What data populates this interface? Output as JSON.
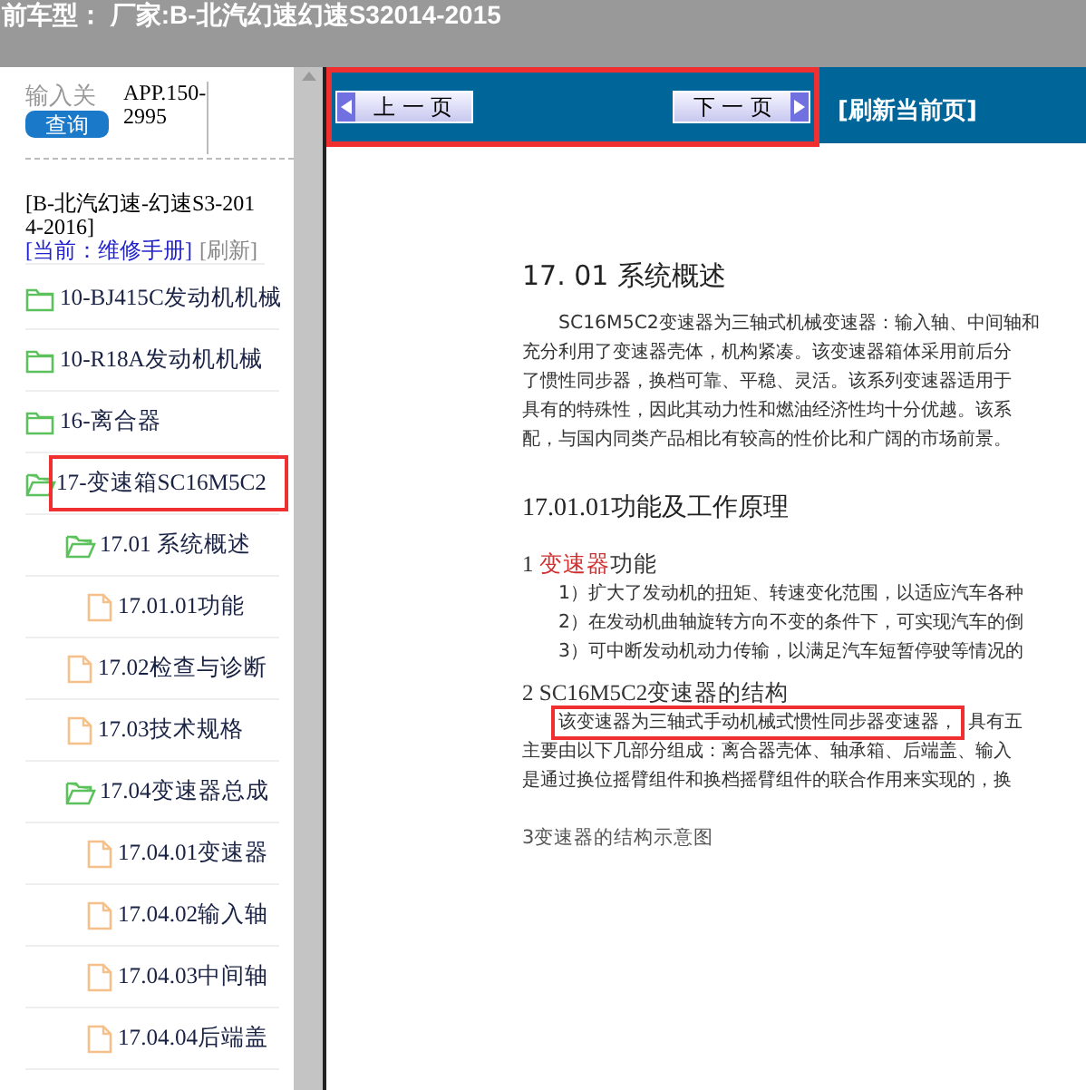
{
  "header": {
    "title": "前车型：  厂家:B-北汽幻速幻速S32014-2015"
  },
  "search": {
    "placeholder": "输入关",
    "code": "APP.150-2995",
    "button": "查询"
  },
  "vehicle": {
    "name": "[B-北汽幻速-幻速S3-2014-2016]",
    "current": "[当前：维修手册]",
    "refresh": "[刷新]"
  },
  "tree": [
    {
      "label": "10-BJ415C发动机机械",
      "kind": "folder",
      "expanded": false,
      "annotated": false
    },
    {
      "label": "10-R18A发动机机械",
      "kind": "folder",
      "expanded": false,
      "annotated": false
    },
    {
      "label": "16-离合器",
      "kind": "folder",
      "expanded": false,
      "annotated": false
    },
    {
      "label": "17-变速箱SC16M5C2",
      "kind": "folder",
      "expanded": true,
      "annotated": true,
      "children": [
        {
          "label": "17.01 系统概述",
          "kind": "folder",
          "expanded": true,
          "annotated": false,
          "children": [
            {
              "label": "17.01.01功能",
              "kind": "file",
              "annotated": false
            }
          ]
        },
        {
          "label": "17.02检查与诊断",
          "kind": "file",
          "annotated": false
        },
        {
          "label": "17.03技术规格",
          "kind": "file",
          "annotated": false
        },
        {
          "label": "17.04变速器总成",
          "kind": "folder",
          "expanded": true,
          "annotated": false,
          "children": [
            {
              "label": "17.04.01变速器",
              "kind": "file",
              "annotated": false
            },
            {
              "label": "17.04.02输入轴",
              "kind": "file",
              "annotated": false
            },
            {
              "label": "17.04.03中间轴",
              "kind": "file",
              "annotated": false
            },
            {
              "label": "17.04.04后端盖",
              "kind": "file",
              "annotated": false
            }
          ]
        }
      ]
    }
  ],
  "pager": {
    "annotated": true,
    "prev": "上 一 页",
    "next": "下 一 页",
    "refresh": "[刷新当前页]"
  },
  "document": [
    {
      "kind": "h1",
      "text": "17. 01 系统概述"
    },
    {
      "kind": "para",
      "lines": [
        {
          "text": "SC16M5C2变速器为三轴式机械变速器：输入轴、中间轴和",
          "indent": true
        },
        {
          "text": "充分利用了变速器壳体，机构紧凑。该变速器箱体采用前后分"
        },
        {
          "text": "了惯性同步器，换档可靠、平稳、灵活。该系列变速器适用于"
        },
        {
          "text": "具有的特殊性，因此其动力性和燃油经济性均十分优越。该系"
        },
        {
          "text": "配，与国内同类产品相比有较高的性价比和广阔的市场前景。"
        }
      ]
    },
    {
      "kind": "h2",
      "text": "17.01.01功能及工作原理"
    },
    {
      "kind": "h3",
      "text": "1 ",
      "highlight": "变速器",
      "after": "功能"
    },
    {
      "kind": "para",
      "lines": [
        {
          "text": "1）扩大了发动机的扭矩、转速变化范围，以适应汽车各种",
          "indent": true
        },
        {
          "text": "2）在发动机曲轴旋转方向不变的条件下，可实现汽车的倒",
          "indent": true
        },
        {
          "text": "3）可中断发动机动力传输，以满足汽车短暂停驶等情况的",
          "indent": true
        }
      ]
    },
    {
      "kind": "h3",
      "text": "2 SC16M5C2变速器的结构"
    },
    {
      "kind": "para",
      "lines": [
        {
          "text": "该变速器为三轴式手动机械式惯性同步器变速器，",
          "rest": "具有五",
          "indent": true,
          "annotated": true
        },
        {
          "text": "主要由以下几部分组成：离合器壳体、轴承箱、后端盖、输入"
        },
        {
          "text": "是通过换位摇臂组件和换档摇臂组件的联合作用来实现的，换"
        }
      ]
    },
    {
      "kind": "caption",
      "text": "3变速器的结构示意图"
    }
  ]
}
